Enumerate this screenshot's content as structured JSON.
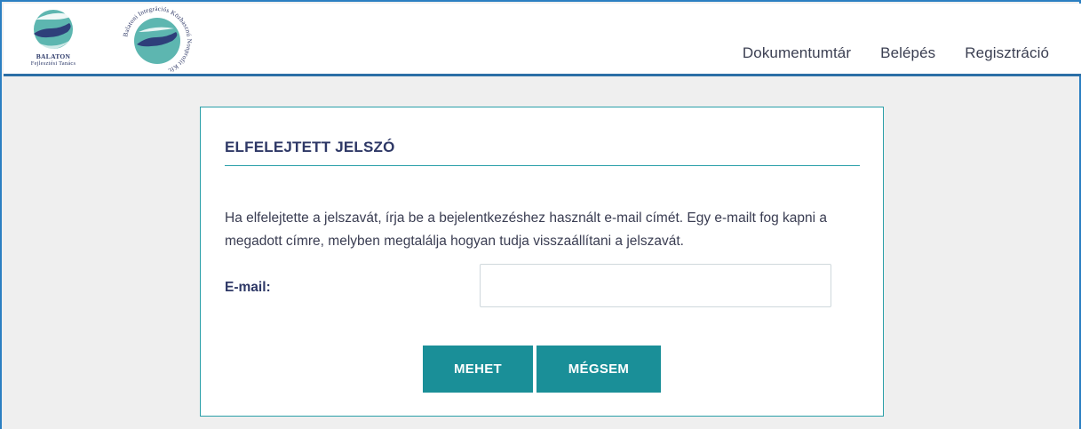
{
  "header": {
    "logo1": {
      "line1": "Balaton",
      "line2": "Fejlesztési Tanács"
    },
    "logo2": {
      "ring_text": "Balatoni Integrációs Közhasznú Nonprofit Kft."
    },
    "nav": [
      {
        "label": "Dokumentumtár"
      },
      {
        "label": "Belépés"
      },
      {
        "label": "Regisztráció"
      }
    ]
  },
  "form": {
    "title": "ELFELEJTETT JELSZÓ",
    "description": "Ha elfelejtette a jelszavát, írja be a bejelentkezéshez használt e-mail címét. Egy e-mailt fog kapni a megadott címre, melyben megtalálja hogyan tudja visszaállítani a jelszavát.",
    "email_label": "E-mail:",
    "email_value": "",
    "submit_label": "MEHET",
    "cancel_label": "MÉGSEM"
  },
  "colors": {
    "accent": "#1a8f98",
    "border": "#2a9fa8",
    "header_rule": "#2b6fa6",
    "title": "#2e3866",
    "background": "#efefef"
  }
}
